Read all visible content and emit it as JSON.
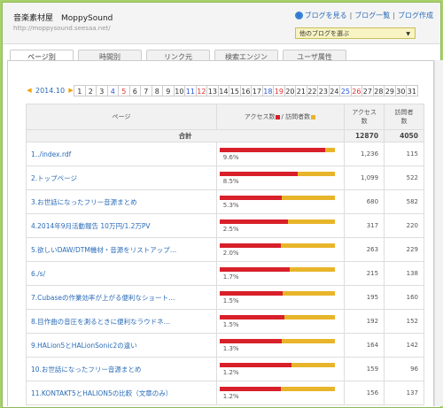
{
  "header": {
    "site_title": "音楽素材屋　MoppySound",
    "site_url": "http://moppysound.seesaa.net/",
    "link_view": "ブログを見る",
    "link_list": "ブログ一覧",
    "link_create": "ブログ作成",
    "blog_select": "他のブログを選ぶ"
  },
  "tabs": [
    "ページ別",
    "時間別",
    "リンク元",
    "検索エンジン",
    "ユーザ属性"
  ],
  "calendar": {
    "month": "2014.10",
    "days": [
      {
        "d": "1",
        "c": ""
      },
      {
        "d": "2",
        "c": ""
      },
      {
        "d": "3",
        "c": ""
      },
      {
        "d": "4",
        "c": "blue"
      },
      {
        "d": "5",
        "c": "red"
      },
      {
        "d": "6",
        "c": ""
      },
      {
        "d": "7",
        "c": ""
      },
      {
        "d": "8",
        "c": ""
      },
      {
        "d": "9",
        "c": ""
      },
      {
        "d": "10",
        "c": ""
      },
      {
        "d": "11",
        "c": "blue"
      },
      {
        "d": "12",
        "c": "red"
      },
      {
        "d": "13",
        "c": ""
      },
      {
        "d": "14",
        "c": ""
      },
      {
        "d": "15",
        "c": ""
      },
      {
        "d": "16",
        "c": ""
      },
      {
        "d": "17",
        "c": ""
      },
      {
        "d": "18",
        "c": "blue"
      },
      {
        "d": "19",
        "c": "red"
      },
      {
        "d": "20",
        "c": ""
      },
      {
        "d": "21",
        "c": ""
      },
      {
        "d": "22",
        "c": ""
      },
      {
        "d": "23",
        "c": ""
      },
      {
        "d": "24",
        "c": ""
      },
      {
        "d": "25",
        "c": "blue"
      },
      {
        "d": "26",
        "c": "red"
      },
      {
        "d": "27",
        "c": ""
      },
      {
        "d": "28",
        "c": ""
      },
      {
        "d": "29",
        "c": ""
      },
      {
        "d": "30",
        "c": ""
      },
      {
        "d": "31",
        "c": ""
      }
    ]
  },
  "table": {
    "col_page": "ページ",
    "col_graph": "アクセス数",
    "col_graph_sep": "/ 訪問者数",
    "col_access_1": "アクセス",
    "col_access_2": "数",
    "col_visitors_1": "訪問者",
    "col_visitors_2": "数",
    "total_label": "合計",
    "total_access": "12870",
    "total_visitors": "4050",
    "rows": [
      {
        "name": "1../index.rdf",
        "pct": "9.6%",
        "access": "1,236",
        "visitors": "115",
        "access_n": 1236,
        "visitors_n": 115
      },
      {
        "name": "2.トップページ",
        "pct": "8.5%",
        "access": "1,099",
        "visitors": "522",
        "access_n": 1099,
        "visitors_n": 522
      },
      {
        "name": "3.お世話になったフリー音源まとめ",
        "pct": "5.3%",
        "access": "680",
        "visitors": "582",
        "access_n": 680,
        "visitors_n": 582
      },
      {
        "name": "4.2014年9月活動報告 10万円/1.2万PV",
        "pct": "2.5%",
        "access": "317",
        "visitors": "220",
        "access_n": 317,
        "visitors_n": 220
      },
      {
        "name": "5.欲しいDAW/DTM機材・音源をリストアップ…",
        "pct": "2.0%",
        "access": "263",
        "visitors": "229",
        "access_n": 263,
        "visitors_n": 229
      },
      {
        "name": "6./s/",
        "pct": "1.7%",
        "access": "215",
        "visitors": "138",
        "access_n": 215,
        "visitors_n": 138
      },
      {
        "name": "7.Cubaseの作業効率が上がる便利なショート…",
        "pct": "1.5%",
        "access": "195",
        "visitors": "160",
        "access_n": 195,
        "visitors_n": 160
      },
      {
        "name": "8.目作曲の音圧を測るときに便利なラウドネ…",
        "pct": "1.5%",
        "access": "192",
        "visitors": "152",
        "access_n": 192,
        "visitors_n": 152
      },
      {
        "name": "9.HALion5とHALionSonic2の違い",
        "pct": "1.3%",
        "access": "164",
        "visitors": "142",
        "access_n": 164,
        "visitors_n": 142
      },
      {
        "name": "10.お世話になったフリー音源まとめ",
        "pct": "1.2%",
        "access": "159",
        "visitors": "96",
        "access_n": 159,
        "visitors_n": 96
      },
      {
        "name": "11.KONTAKT5とHALION5の比較（文章のみ）",
        "pct": "1.2%",
        "access": "156",
        "visitors": "137",
        "access_n": 156,
        "visitors_n": 137
      }
    ]
  },
  "colors": {
    "access": "#d8202a",
    "visitors": "#e8b52a"
  }
}
